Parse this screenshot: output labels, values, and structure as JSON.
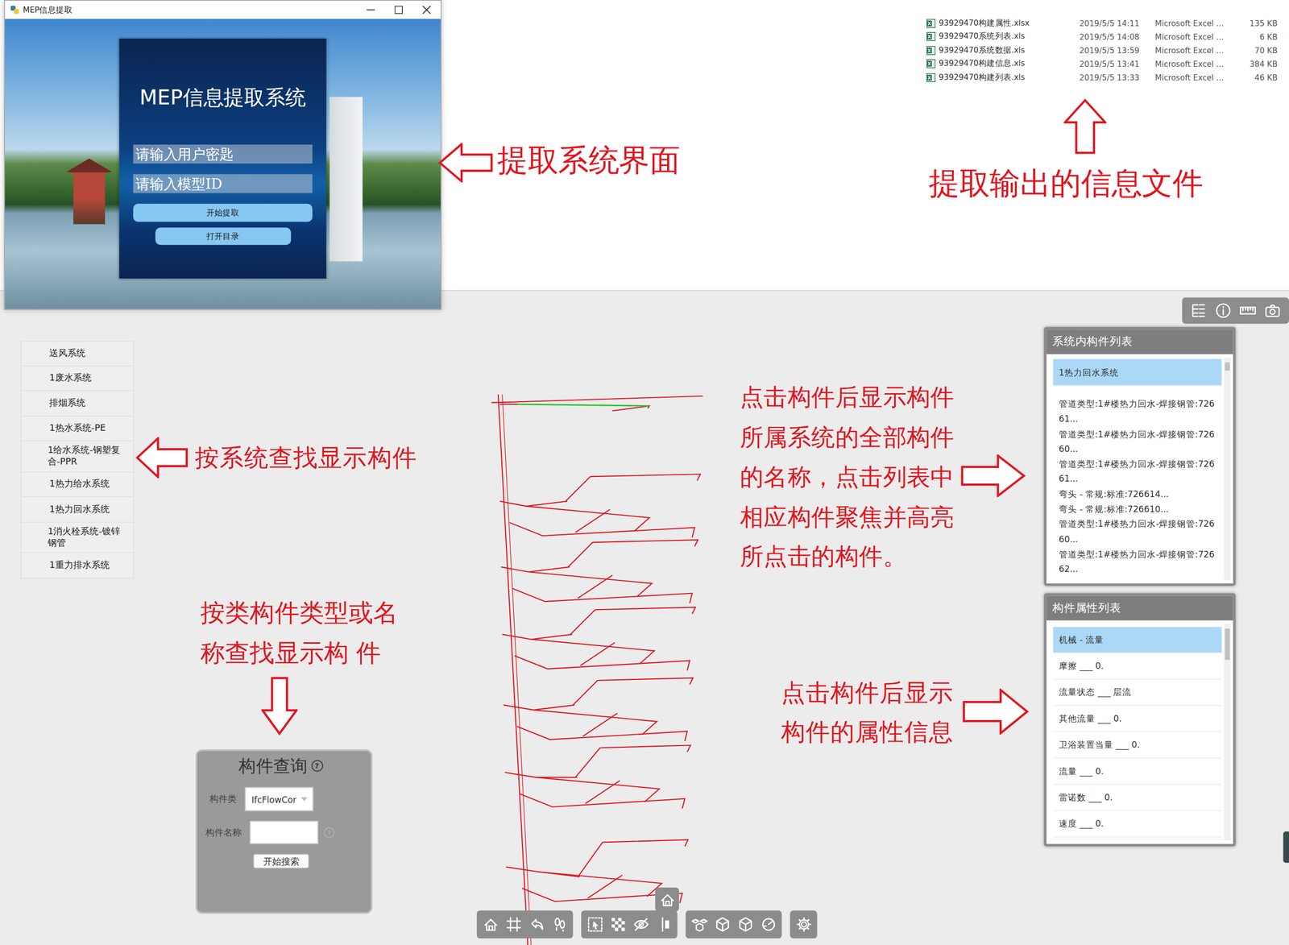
{
  "app_window": {
    "title": "MEP信息提取",
    "heading": "MEP信息提取系统",
    "key_placeholder": "请输入用户密匙",
    "id_placeholder": "请输入模型ID",
    "buttons": [
      "开始提取",
      "打开目录"
    ]
  },
  "files": [
    {
      "name": "93929470构建属性.xlsx",
      "date": "2019/5/5 14:11",
      "type": "Microsoft Excel ...",
      "size": "135 KB"
    },
    {
      "name": "93929470系统列表.xls",
      "date": "2019/5/5 14:08",
      "type": "Microsoft Excel ...",
      "size": "6 KB"
    },
    {
      "name": "93929470系统数据.xls",
      "date": "2019/5/5 13:59",
      "type": "Microsoft Excel ...",
      "size": "70 KB"
    },
    {
      "name": "93929470构建信息.xls",
      "date": "2019/5/5 13:41",
      "type": "Microsoft Excel ...",
      "size": "384 KB"
    },
    {
      "name": "93929470构建列表.xls",
      "date": "2019/5/5 13:33",
      "type": "Microsoft Excel ...",
      "size": "46 KB"
    }
  ],
  "annotations": {
    "extract_ui": [
      "提取系统界面"
    ],
    "output_files": [
      "提取输出的信息文件"
    ],
    "system_search": [
      "按系统查找显示构件"
    ],
    "type_search": [
      "按类构件类型或名",
      "称查找显示构 件"
    ],
    "component_note": [
      "点击构件后显示构件",
      "所属系统的全部构件",
      "的名称，点击列表中",
      "相应构件聚焦并高亮",
      "所点击的构件。"
    ],
    "property_note": [
      "点击构件后显示",
      "构件的属性信息"
    ]
  },
  "systems": [
    "送风系统",
    "1废水系统",
    "排烟系统",
    "1热水系统-PE",
    "1给水系统-钢塑复合-PPR",
    "1热力给水系统",
    "1热力回水系统",
    "1消火栓系统-镀锌钢管",
    "1重力排水系统"
  ],
  "query": {
    "title": "构件查询",
    "help": "?",
    "class_label": "构件类",
    "class_value": "IfcFlowCor",
    "name_label": "构件名称",
    "name_help": "?",
    "button": "开始搜索"
  },
  "component_list": {
    "title": "系统内构件列表",
    "items": [
      {
        "text": "1热力回水系统",
        "selected": true
      },
      {
        "text": "管道类型:1#楼热力回水-焊接钢管:72661...",
        "selected": false
      },
      {
        "text": "管道类型:1#楼热力回水-焊接钢管:72660...",
        "selected": false
      },
      {
        "text": "管道类型:1#楼热力回水-焊接钢管:72661...",
        "selected": false
      },
      {
        "text": "弯头 - 常规:标准:726614...",
        "selected": false
      },
      {
        "text": "弯头 - 常规:标准:726610...",
        "selected": false
      },
      {
        "text": "管道类型:1#楼热力回水-焊接钢管:72660...",
        "selected": false
      },
      {
        "text": "管道类型:1#楼热力回水-焊接钢管:72662...",
        "selected": false
      }
    ]
  },
  "property_list": {
    "title": "构件属性列表",
    "items": [
      {
        "text": "机械 - 流量",
        "selected": true
      },
      {
        "text": "摩擦 ___ 0.",
        "selected": false
      },
      {
        "text": "流量状态 ___ 层流",
        "selected": false
      },
      {
        "text": "其他流量 ___ 0.",
        "selected": false
      },
      {
        "text": "卫浴装置当量 ___ 0.",
        "selected": false
      },
      {
        "text": "流量 ___ 0.",
        "selected": false
      },
      {
        "text": "雷诺数 ___ 0.",
        "selected": false
      },
      {
        "text": "速度 ___ 0.",
        "selected": false
      }
    ]
  }
}
